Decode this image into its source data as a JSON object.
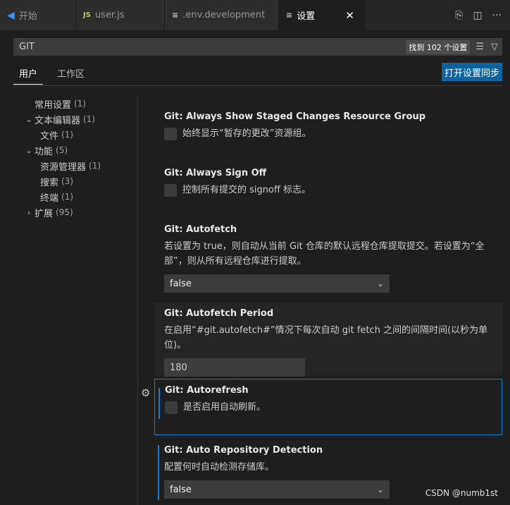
{
  "tabs": [
    {
      "label": "开始",
      "icon": "vscode-logo-icon"
    },
    {
      "label": "user.js",
      "icon": "js-file-icon"
    },
    {
      "label": ".env.development",
      "icon": "env-file-icon"
    },
    {
      "label": "设置",
      "icon": "settings-file-icon",
      "active": true
    }
  ],
  "search": {
    "value": "GIT",
    "result_count": "找到 102 个设置"
  },
  "scope_tabs": [
    "用户",
    "工作区"
  ],
  "sync_button": "打开设置同步",
  "toc": [
    {
      "label": "常用设置",
      "count": "(1)"
    },
    {
      "label": "文本编辑器",
      "count": "(1)"
    },
    {
      "label": "文件",
      "count": "(1)"
    },
    {
      "label": "功能",
      "count": "(5)"
    },
    {
      "label": "资源管理器",
      "count": "(1)"
    },
    {
      "label": "搜索",
      "count": "(3)"
    },
    {
      "label": "终端",
      "count": "(1)"
    },
    {
      "label": "扩展",
      "count": "(95)"
    }
  ],
  "settings": [
    {
      "prefix": "Git: ",
      "name": "Always Show Staged Changes Resource Group",
      "desc": "始终显示“暂存的更改”资源组。"
    },
    {
      "prefix": "Git: ",
      "name": "Always Sign Off",
      "desc": "控制所有提交的 signoff 标志。"
    },
    {
      "prefix": "Git: ",
      "name": "Autofetch",
      "desc": "若设置为 true，则自动从当前 Git 仓库的默认远程仓库提取提交。若设置为“全部”，则从所有远程仓库进行提取。",
      "value": "false"
    },
    {
      "prefix": "Git: ",
      "name": "Autofetch Period",
      "desc": "在启用“#git.autofetch#”情况下每次自动 git fetch 之间的间隔时间(以秒为单位)。",
      "value": "180"
    },
    {
      "prefix": "Git: ",
      "name": "Autorefresh",
      "desc": "是否启用自动刷新。"
    },
    {
      "prefix": "Git: ",
      "name": "Auto Repository Detection",
      "desc": "配置何时自动检测存储库。",
      "value": "false"
    }
  ],
  "watermark": "CSDN @numb1st",
  "colors": {
    "accent": "#0e639c",
    "focus": "#007fd4",
    "modified": "#0c7dd6"
  }
}
